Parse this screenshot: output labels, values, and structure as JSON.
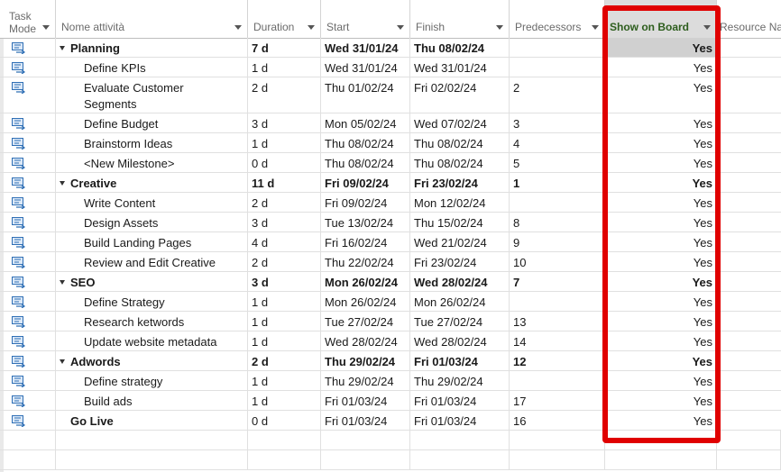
{
  "columns": {
    "task_mode": "Task\nMode",
    "task_mode_line1": "Task",
    "task_mode_line2": "Mode",
    "name": "Nome attività",
    "duration": "Duration",
    "start": "Start",
    "finish": "Finish",
    "predecessors": "Predecessors",
    "show_on_board": "Show on Board",
    "resource": "Resource Na"
  },
  "rows": [
    {
      "name": "Planning",
      "duration": "7 d",
      "start": "Wed 31/01/24",
      "finish": "Thu 08/02/24",
      "pred": "",
      "board": "Yes",
      "summary": true
    },
    {
      "name": "Define KPIs",
      "duration": "1 d",
      "start": "Wed 31/01/24",
      "finish": "Wed 31/01/24",
      "pred": "",
      "board": "Yes",
      "summary": false
    },
    {
      "name": "Evaluate Customer Segments",
      "duration": "2 d",
      "start": "Thu 01/02/24",
      "finish": "Fri 02/02/24",
      "pred": "2",
      "board": "Yes",
      "summary": false
    },
    {
      "name": "Define Budget",
      "duration": "3 d",
      "start": "Mon 05/02/24",
      "finish": "Wed 07/02/24",
      "pred": "3",
      "board": "Yes",
      "summary": false
    },
    {
      "name": "Brainstorm Ideas",
      "duration": "1 d",
      "start": "Thu 08/02/24",
      "finish": "Thu 08/02/24",
      "pred": "4",
      "board": "Yes",
      "summary": false
    },
    {
      "name": "<New Milestone>",
      "duration": "0 d",
      "start": "Thu 08/02/24",
      "finish": "Thu 08/02/24",
      "pred": "5",
      "board": "Yes",
      "summary": false
    },
    {
      "name": "Creative",
      "duration": "11 d",
      "start": "Fri 09/02/24",
      "finish": "Fri 23/02/24",
      "pred": "1",
      "board": "Yes",
      "summary": true
    },
    {
      "name": "Write Content",
      "duration": "2 d",
      "start": "Fri 09/02/24",
      "finish": "Mon 12/02/24",
      "pred": "",
      "board": "Yes",
      "summary": false
    },
    {
      "name": "Design Assets",
      "duration": "3 d",
      "start": "Tue 13/02/24",
      "finish": "Thu 15/02/24",
      "pred": "8",
      "board": "Yes",
      "summary": false
    },
    {
      "name": "Build Landing Pages",
      "duration": "4 d",
      "start": "Fri 16/02/24",
      "finish": "Wed 21/02/24",
      "pred": "9",
      "board": "Yes",
      "summary": false
    },
    {
      "name": "Review and Edit Creative",
      "duration": "2 d",
      "start": "Thu 22/02/24",
      "finish": "Fri 23/02/24",
      "pred": "10",
      "board": "Yes",
      "summary": false
    },
    {
      "name": "SEO",
      "duration": "3 d",
      "start": "Mon 26/02/24",
      "finish": "Wed 28/02/24",
      "pred": "7",
      "board": "Yes",
      "summary": true
    },
    {
      "name": "Define Strategy",
      "duration": "1 d",
      "start": "Mon 26/02/24",
      "finish": "Mon 26/02/24",
      "pred": "",
      "board": "Yes",
      "summary": false
    },
    {
      "name": "Research ketwords",
      "duration": "1 d",
      "start": "Tue 27/02/24",
      "finish": "Tue 27/02/24",
      "pred": "13",
      "board": "Yes",
      "summary": false
    },
    {
      "name": "Update website metadata",
      "duration": "1 d",
      "start": "Wed 28/02/24",
      "finish": "Wed 28/02/24",
      "pred": "14",
      "board": "Yes",
      "summary": false
    },
    {
      "name": "Adwords",
      "duration": "2 d",
      "start": "Thu 29/02/24",
      "finish": "Fri 01/03/24",
      "pred": "12",
      "board": "Yes",
      "summary": true
    },
    {
      "name": "Define strategy",
      "duration": "1 d",
      "start": "Thu 29/02/24",
      "finish": "Thu 29/02/24",
      "pred": "",
      "board": "Yes",
      "summary": false
    },
    {
      "name": "Build ads",
      "duration": "1 d",
      "start": "Fri 01/03/24",
      "finish": "Fri 01/03/24",
      "pred": "17",
      "board": "Yes",
      "summary": false
    },
    {
      "name": "Go Live",
      "duration": "0 d",
      "start": "Fri 01/03/24",
      "finish": "Fri 01/03/24",
      "pred": "16",
      "board": "Yes",
      "summary": false,
      "toplevel": true
    }
  ],
  "icons": {
    "task_mode": "auto-scheduled-task-icon",
    "outline": "collapse-triangle-icon",
    "filter": "dropdown-arrow-icon"
  },
  "colors": {
    "highlight_border": "#e00000",
    "board_header_text": "#2e5e1e",
    "mode_icon": "#2f6fb5"
  }
}
